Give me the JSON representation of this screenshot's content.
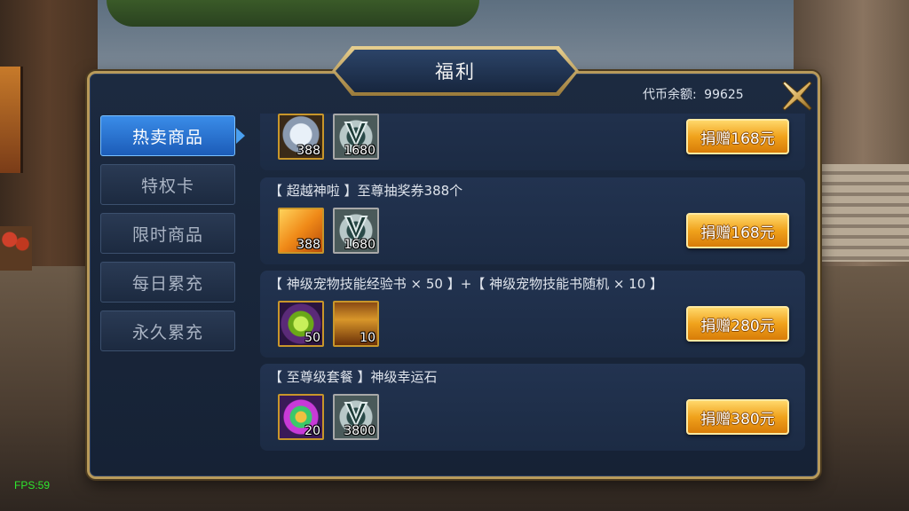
{
  "header": {
    "title": "福利",
    "balance_label": "代币余额:",
    "balance_value": "99625"
  },
  "sidebar": {
    "items": [
      {
        "label": "热卖商品",
        "active": true
      },
      {
        "label": "特权卡",
        "active": false
      },
      {
        "label": "限时商品",
        "active": false
      },
      {
        "label": "每日累充",
        "active": false
      },
      {
        "label": "永久累充",
        "active": false
      }
    ]
  },
  "products": [
    {
      "title": "",
      "rewards": [
        {
          "icon": "chest-gift-icon",
          "qty": "388"
        },
        {
          "icon": "v-emblem-icon",
          "qty": "1680"
        }
      ],
      "button": "捐赠168元"
    },
    {
      "title": "【 超越神啦 】至尊抽奖券388个",
      "rewards": [
        {
          "icon": "lottery-ticket-icon",
          "qty": "388"
        },
        {
          "icon": "v-emblem-icon",
          "qty": "1680"
        }
      ],
      "button": "捐赠168元"
    },
    {
      "title": "【 神级宠物技能经验书 × 50 】+【 神级宠物技能书随机 × 10 】",
      "rewards": [
        {
          "icon": "green-gem-book-icon",
          "qty": "50"
        },
        {
          "icon": "treasure-chest-icon",
          "qty": "10"
        }
      ],
      "button": "捐赠280元"
    },
    {
      "title": "【 至尊级套餐 】神级幸运石",
      "rewards": [
        {
          "icon": "lucky-stone-icon",
          "qty": "20"
        },
        {
          "icon": "v-emblem-icon",
          "qty": "3800"
        }
      ],
      "button": "捐赠380元"
    }
  ],
  "fps": "FPS:59",
  "colors": {
    "accent_blue": "#2a78d8",
    "gold_button": "#f0a21c",
    "panel_border": "#b89a5a"
  }
}
